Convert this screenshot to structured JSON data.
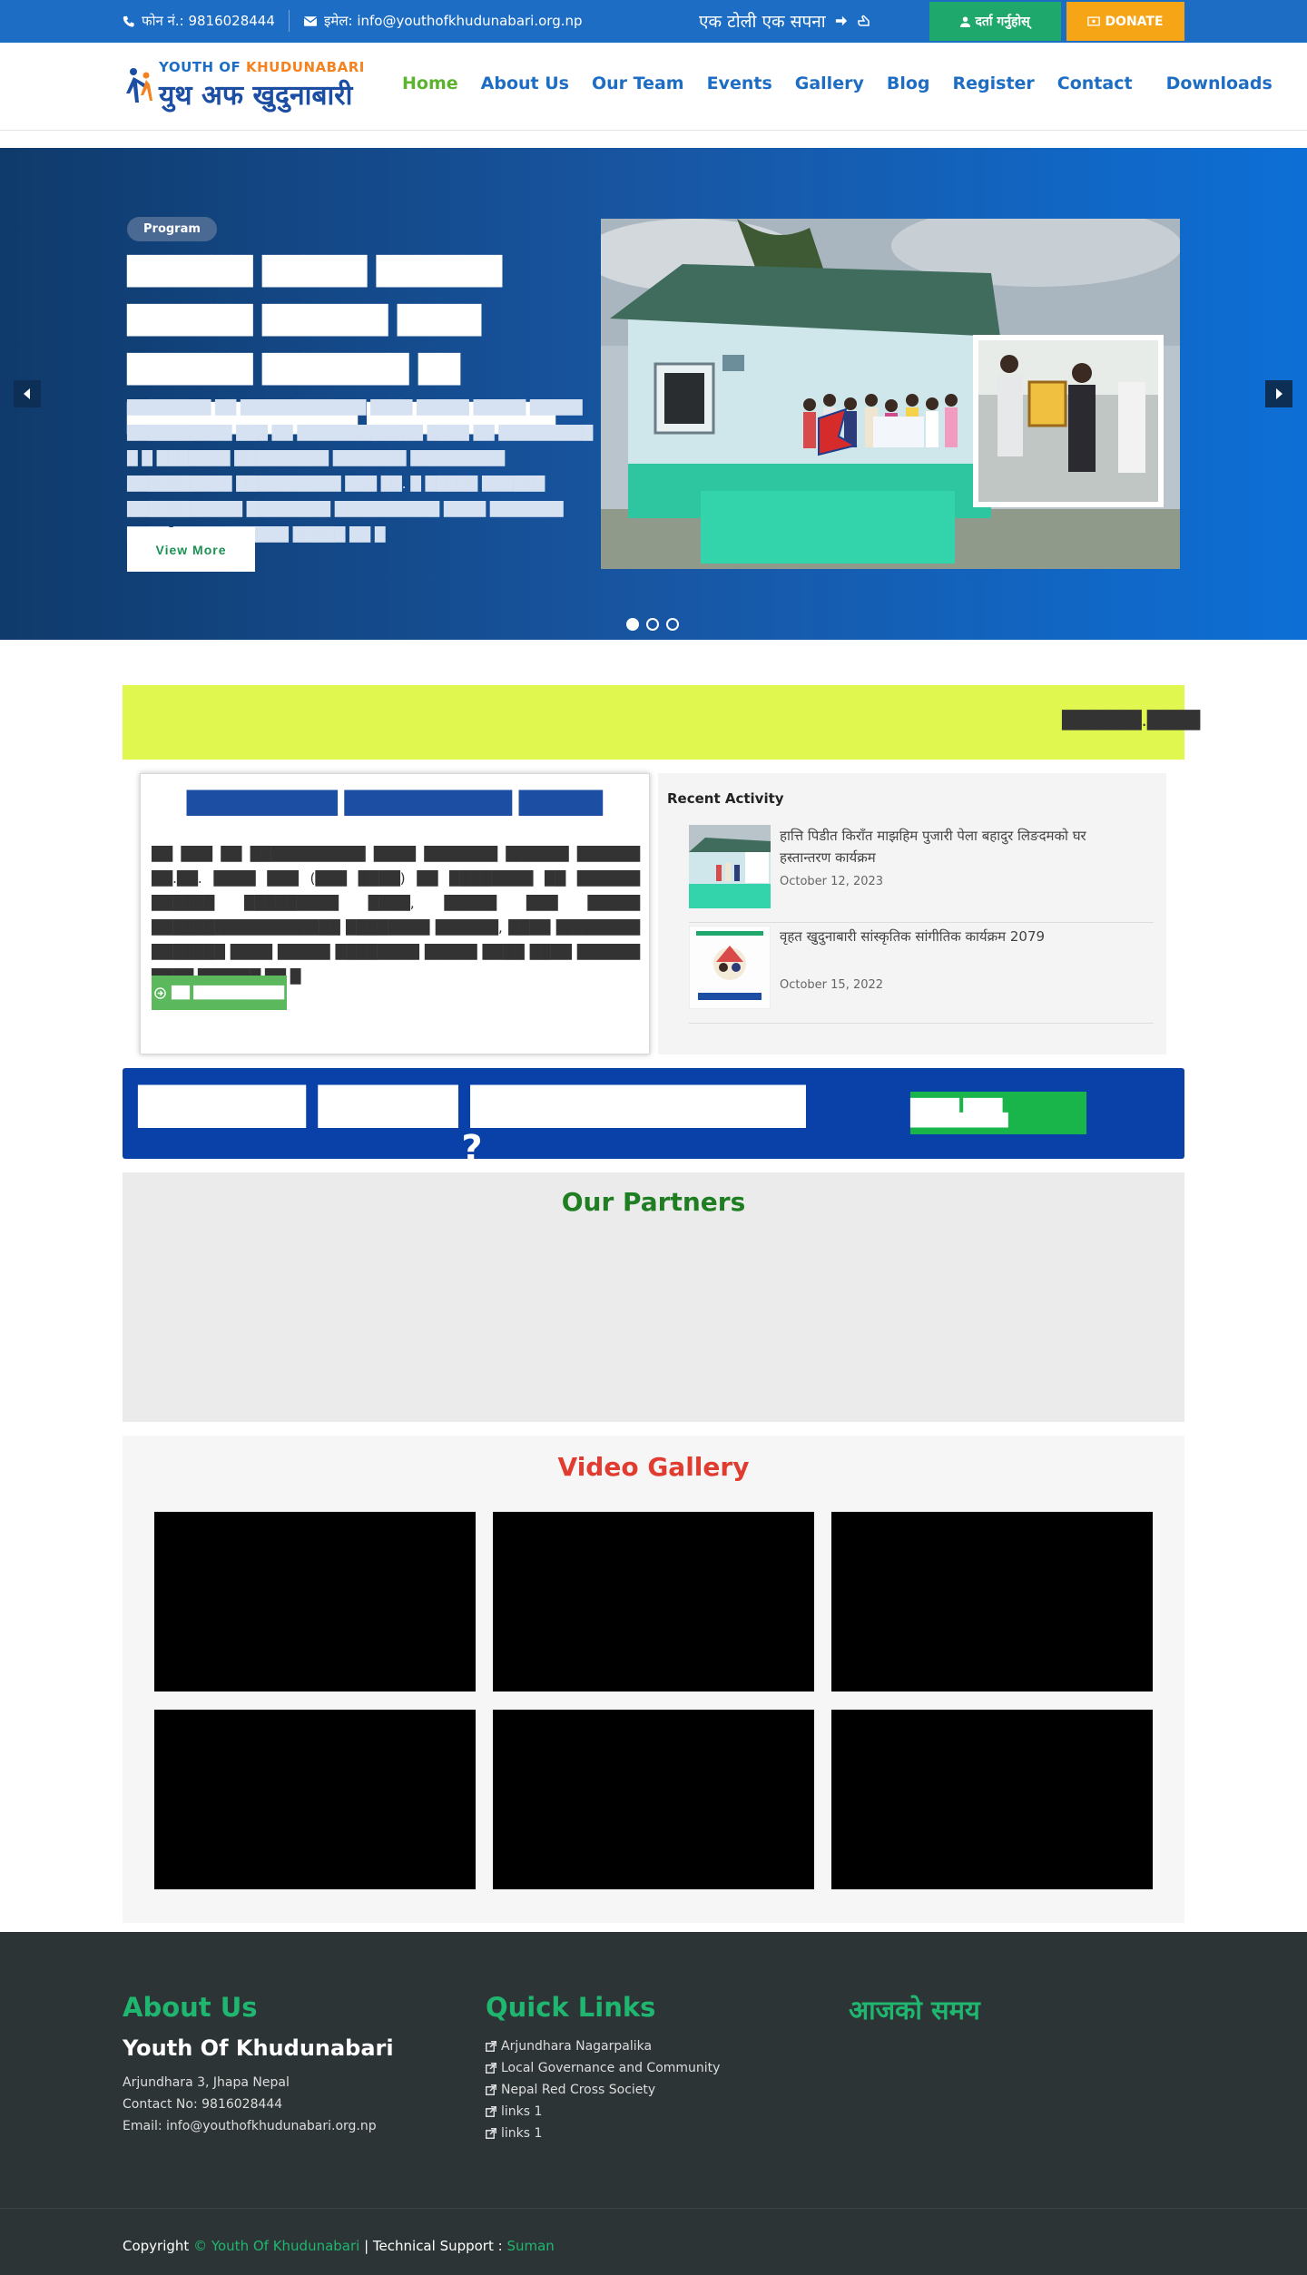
{
  "topbar": {
    "phone": "फोन नं.: 9816028444",
    "email": "इमेल: info@youthofkhudunabari.org.np",
    "slogan": "एक टोली एक सपना",
    "register_label": "दर्ता गर्नुहोस्",
    "donate_label": "DONATE"
  },
  "header": {
    "logo_line1_a": "YOUTH OF ",
    "logo_line1_b": "KHUDUNABARI",
    "logo_line2": "युथ अफ खुदुनाबारी",
    "nav": [
      "Home",
      "About Us",
      "Our Team",
      "Events",
      "Gallery",
      "Blog",
      "Register",
      "Contact",
      "Downloads"
    ]
  },
  "hero": {
    "tag": "Program",
    "title": "██████ █████ ██████ ██████ ██████ ████ ██████ ███████ ██ ███████████ █████████",
    "description": "████████ ██ ████████████ ████ █████ █████ █████ ██████████ ███ ██ ████████████ ████ ██ █████████ █ █ ███████ █████████ ███████ █████████ ██████████ ██████████ ███ ██. █ █████ ██████ ███████████ ████████ ██████████ ████ ███████ ████ ███████████ █████ ██ █",
    "button": "View More",
    "prev_icon": "caret-left-icon",
    "next_icon": "caret-right-icon"
  },
  "marquee": {
    "text": "██████.████"
  },
  "intro": {
    "heading": "█████████ ██████████ █████",
    "body": "██ ███ ██ ███████████ ████ ███████ ██████ ██████ ██.██. ████ ███ (███ ████) ██ ████████ ██ ██████ ██████ █████████ ████, █████ ███ █████ ██████████████████ ████████ ██████, ████ ████████ ███████ ████ █████ ████████ █████ ████ ████ ██████ ████ ██████ ██ █",
    "button": "██ ██████████"
  },
  "recent": {
    "heading": "Recent Activity",
    "items": [
      {
        "title": "हात्ति पिडीत किराँत माझहिम पुजारी पेला बहादुर लिङदमको घर हस्तान्तरण कार्यक्रम",
        "date": "October 12, 2023"
      },
      {
        "title": "वृहत खुदुनाबारी सांस्कृतिक सांगीतिक कार्यक्रम 2079",
        "date": "October 15, 2022"
      }
    ]
  },
  "cta": {
    "heading": "██████ █████ ████████████ ?",
    "button": "█████ ████ ██████████"
  },
  "partners": {
    "heading": "Our Partners"
  },
  "videos": {
    "heading": "Video Gallery"
  },
  "footer": {
    "about_heading": "About Us",
    "org_name": "Youth Of Khudunabari",
    "address": "Arjundhara 3, Jhapa Nepal",
    "contact": "Contact No: 9816028444",
    "email": "Email: info@youthofkhudunabari.org.np",
    "links_heading": "Quick Links",
    "links": [
      "Arjundhara Nagarpalika",
      "Local Governance and Community",
      "Nepal Red Cross Society",
      "links 1",
      "links 1"
    ],
    "time_heading": "आजको समय",
    "copyright_prefix": "Copyright ",
    "copyright_brand": "© Youth Of Khudunabari",
    "support_text": " | Technical Support : ",
    "support_name": "Suman"
  },
  "colors": {
    "topbar": "#1c6dc3",
    "nav_link": "#1c6dc3",
    "nav_active": "#5cb32e",
    "register": "#1fa86b",
    "donate": "#f5a515",
    "marquee": "#e0f750",
    "cta": "#0a41a8",
    "footer": "#2d3436",
    "footer_accent": "#1fb76f"
  }
}
